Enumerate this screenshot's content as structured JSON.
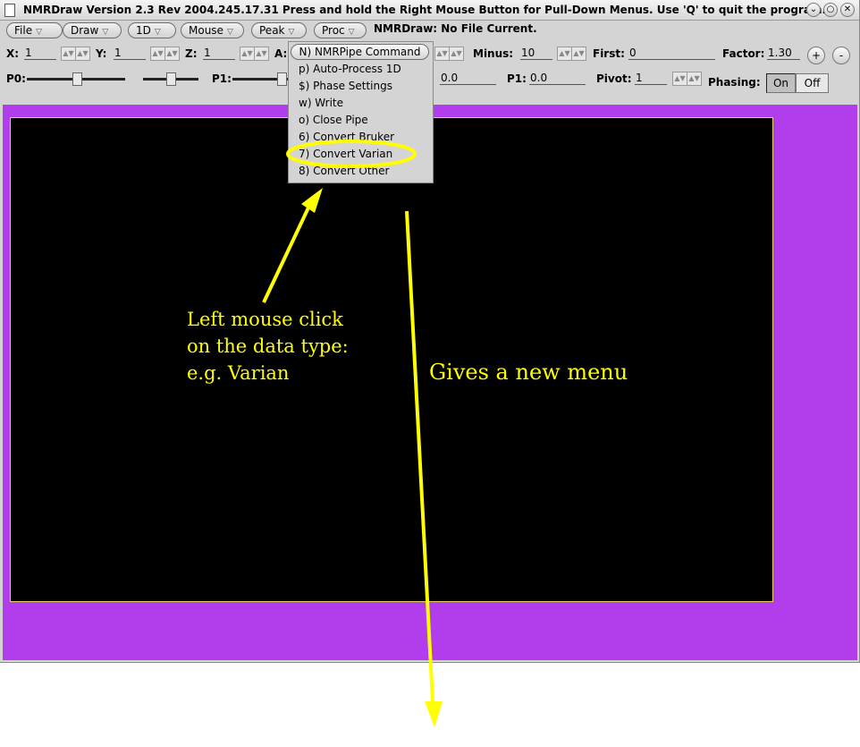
{
  "window": {
    "title": "NMRDraw Version 2.3 Rev 2004.245.17.31   Press and hold the Right Mouse Button for Pull-Down Menus.   Use 'Q' to quit the program.",
    "controls": [
      "⌄",
      "○",
      "✕"
    ]
  },
  "menubar": [
    {
      "label": "File"
    },
    {
      "label": "Draw"
    },
    {
      "label": "1D"
    },
    {
      "label": "Mouse"
    },
    {
      "label": "Peak"
    },
    {
      "label": "Proc"
    }
  ],
  "menu_arrow": "▽",
  "status": "NMRDraw: No File Current.",
  "row1": {
    "x_label": "X:",
    "x_value": "1",
    "y_label": "Y:",
    "y_value": "1",
    "z_label": "Z:",
    "z_value": "1",
    "a_label": "A:",
    "minus_label": "Minus:",
    "minus_value": "10",
    "first_label": "First:",
    "first_value": "0",
    "factor_label": "Factor:",
    "factor_value": "1.30",
    "plus_button": "+",
    "minus_button": "-"
  },
  "row2": {
    "p0_label": "P0:",
    "p1_label": "P1:",
    "p0_value": "0.0",
    "p1_field_label": "P1:",
    "p1_value": "0.0",
    "pivot_label": "Pivot:",
    "pivot_value": "1",
    "phasing_label": "Phasing:",
    "on_label": "On",
    "off_label": "Off"
  },
  "spin_glyph": "▲▼",
  "proc_menu": {
    "title": "N) NMRPipe Command",
    "items": [
      "p) Auto-Process 1D",
      "$) Phase Settings",
      "w) Write",
      "o) Close Pipe",
      "6) Convert Bruker",
      "7) Convert Varian",
      "8) Convert Other"
    ]
  },
  "annotations": {
    "left_line1": "Left mouse click",
    "left_line2": "on the data type:",
    "left_line3": "e.g. Varian",
    "right": "Gives a new menu"
  },
  "colors": {
    "canvas_bg": "#b23ded",
    "plot_bg": "#000000",
    "annotation": "#ffff00"
  }
}
